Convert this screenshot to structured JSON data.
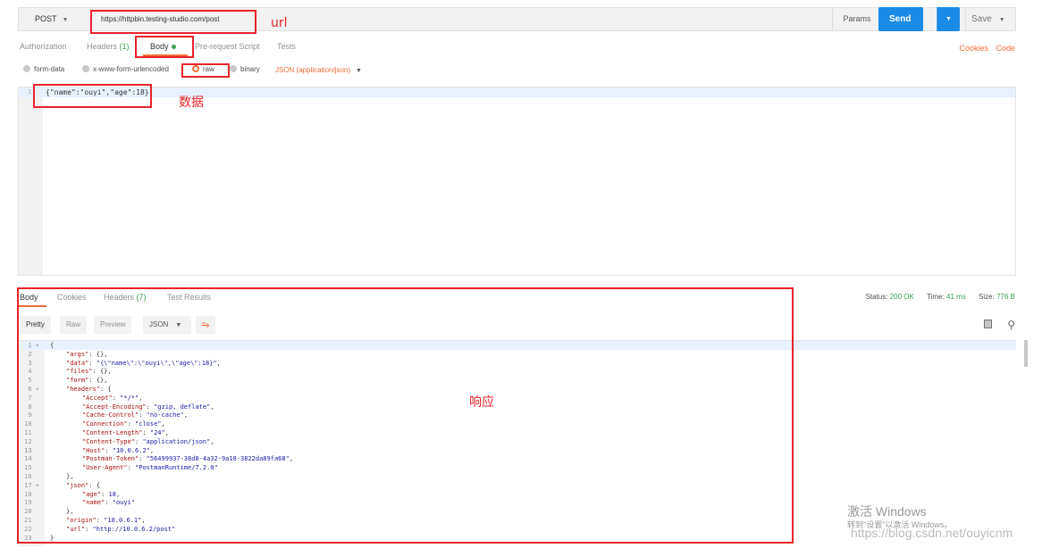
{
  "request": {
    "method": "POST",
    "url": "https://httpbin.testing-studio.com/post",
    "params_label": "Params",
    "send_label": "Send",
    "save_label": "Save"
  },
  "request_tabs": [
    {
      "label": "Authorization"
    },
    {
      "label": "Headers",
      "count": "(1)"
    },
    {
      "label": "Body"
    },
    {
      "label": "Pre-request Script"
    },
    {
      "label": "Tests"
    }
  ],
  "right_links": {
    "cookies": "Cookies",
    "code": "Code"
  },
  "body_types": {
    "form_data": "form-data",
    "urlencoded": "x-www-form-urlencoded",
    "raw": "raw",
    "binary": "binary",
    "content_type": "JSON (application/json)"
  },
  "request_body": {
    "line_number": "1",
    "text": "{\"name\":\"ouyi\",\"age\":18}"
  },
  "annotations": {
    "url": "url",
    "data": "数据",
    "response": "响应"
  },
  "response_tabs": [
    {
      "label": "Body"
    },
    {
      "label": "Cookies"
    },
    {
      "label": "Headers",
      "count": "(7)"
    },
    {
      "label": "Test Results"
    }
  ],
  "status": {
    "status_label": "Status:",
    "status_value": "200 OK",
    "time_label": "Time:",
    "time_value": "41 ms",
    "size_label": "Size:",
    "size_value": "776 B"
  },
  "view_modes": {
    "pretty": "Pretty",
    "raw": "Raw",
    "preview": "Preview",
    "format": "JSON"
  },
  "icons": {
    "wrap": "wrap-lines-icon",
    "copy": "copy-icon",
    "search": "search-icon"
  },
  "response_lines": [
    {
      "n": "1",
      "fold": true,
      "indent": 0,
      "parts": [
        [
          "p",
          "{"
        ]
      ]
    },
    {
      "n": "2",
      "indent": 1,
      "parts": [
        [
          "k",
          "\"args\""
        ],
        [
          "p",
          ": {},"
        ]
      ]
    },
    {
      "n": "3",
      "indent": 1,
      "parts": [
        [
          "k",
          "\"data\""
        ],
        [
          "p",
          ": "
        ],
        [
          "s",
          "\"{\\\"name\\\":\\\"ouyi\\\",\\\"age\\\":18}\""
        ],
        [
          "p",
          ","
        ]
      ]
    },
    {
      "n": "4",
      "indent": 1,
      "parts": [
        [
          "k",
          "\"files\""
        ],
        [
          "p",
          ": {},"
        ]
      ]
    },
    {
      "n": "5",
      "indent": 1,
      "parts": [
        [
          "k",
          "\"form\""
        ],
        [
          "p",
          ": {},"
        ]
      ]
    },
    {
      "n": "6",
      "fold": true,
      "indent": 1,
      "parts": [
        [
          "k",
          "\"headers\""
        ],
        [
          "p",
          ": {"
        ]
      ]
    },
    {
      "n": "7",
      "indent": 2,
      "parts": [
        [
          "k",
          "\"Accept\""
        ],
        [
          "p",
          ": "
        ],
        [
          "s",
          "\"*/*\""
        ],
        [
          "p",
          ","
        ]
      ]
    },
    {
      "n": "8",
      "indent": 2,
      "parts": [
        [
          "k",
          "\"Accept-Encoding\""
        ],
        [
          "p",
          ": "
        ],
        [
          "s",
          "\"gzip, deflate\""
        ],
        [
          "p",
          ","
        ]
      ]
    },
    {
      "n": "9",
      "indent": 2,
      "parts": [
        [
          "k",
          "\"Cache-Control\""
        ],
        [
          "p",
          ": "
        ],
        [
          "s",
          "\"no-cache\""
        ],
        [
          "p",
          ","
        ]
      ]
    },
    {
      "n": "10",
      "indent": 2,
      "parts": [
        [
          "k",
          "\"Connection\""
        ],
        [
          "p",
          ": "
        ],
        [
          "s",
          "\"close\""
        ],
        [
          "p",
          ","
        ]
      ]
    },
    {
      "n": "11",
      "indent": 2,
      "parts": [
        [
          "k",
          "\"Content-Length\""
        ],
        [
          "p",
          ": "
        ],
        [
          "s",
          "\"24\""
        ],
        [
          "p",
          ","
        ]
      ]
    },
    {
      "n": "12",
      "indent": 2,
      "parts": [
        [
          "k",
          "\"Content-Type\""
        ],
        [
          "p",
          ": "
        ],
        [
          "s",
          "\"application/json\""
        ],
        [
          "p",
          ","
        ]
      ]
    },
    {
      "n": "13",
      "indent": 2,
      "parts": [
        [
          "k",
          "\"Host\""
        ],
        [
          "p",
          ": "
        ],
        [
          "s",
          "\"10.0.6.2\""
        ],
        [
          "p",
          ","
        ]
      ]
    },
    {
      "n": "14",
      "indent": 2,
      "parts": [
        [
          "k",
          "\"Postman-Token\""
        ],
        [
          "p",
          ": "
        ],
        [
          "s",
          "\"56499937-38d8-4a32-9a18-3822da89fa68\""
        ],
        [
          "p",
          ","
        ]
      ]
    },
    {
      "n": "15",
      "indent": 2,
      "parts": [
        [
          "k",
          "\"User-Agent\""
        ],
        [
          "p",
          ": "
        ],
        [
          "s",
          "\"PostmanRuntime/7.2.0\""
        ]
      ]
    },
    {
      "n": "16",
      "indent": 1,
      "parts": [
        [
          "p",
          "},"
        ]
      ]
    },
    {
      "n": "17",
      "fold": true,
      "indent": 1,
      "parts": [
        [
          "k",
          "\"json\""
        ],
        [
          "p",
          ": {"
        ]
      ]
    },
    {
      "n": "18",
      "indent": 2,
      "parts": [
        [
          "k",
          "\"age\""
        ],
        [
          "p",
          ": "
        ],
        [
          "n",
          "18"
        ],
        [
          "p",
          ","
        ]
      ]
    },
    {
      "n": "19",
      "indent": 2,
      "parts": [
        [
          "k",
          "\"name\""
        ],
        [
          "p",
          ": "
        ],
        [
          "s",
          "\"ouyi\""
        ]
      ]
    },
    {
      "n": "20",
      "indent": 1,
      "parts": [
        [
          "p",
          "},"
        ]
      ]
    },
    {
      "n": "21",
      "indent": 1,
      "parts": [
        [
          "k",
          "\"origin\""
        ],
        [
          "p",
          ": "
        ],
        [
          "s",
          "\"10.0.6.1\""
        ],
        [
          "p",
          ","
        ]
      ]
    },
    {
      "n": "22",
      "indent": 1,
      "parts": [
        [
          "k",
          "\"url\""
        ],
        [
          "p",
          ": "
        ],
        [
          "s",
          "\"http://10.0.6.2/post\""
        ]
      ]
    },
    {
      "n": "23",
      "indent": 0,
      "parts": [
        [
          "p",
          "}"
        ]
      ]
    }
  ],
  "watermark": {
    "activate": "激活 Windows",
    "goto": "转到\"设置\"以激活 Windows。",
    "blog": "https://blog.csdn.net/ouyicnm"
  }
}
